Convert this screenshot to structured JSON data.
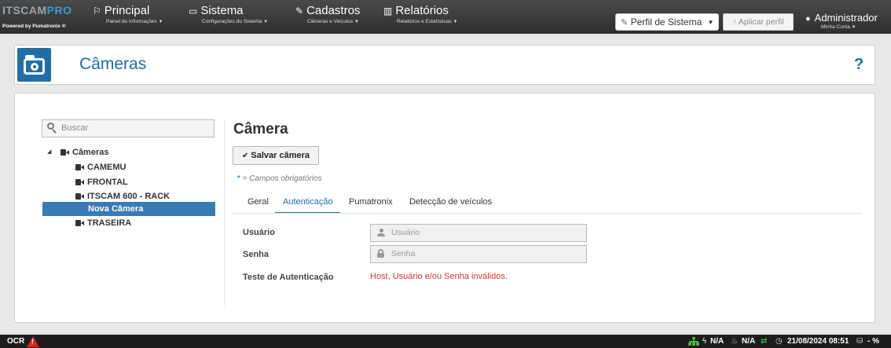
{
  "navbar": {
    "brand_name": "ITSCAMPRO",
    "brand_sub": "Powered by Pumatronix ®",
    "items": [
      {
        "icon": "flag-icon",
        "glyph": "⚐",
        "title": "Principal",
        "subtitle": "Painel de Informações"
      },
      {
        "icon": "monitor-icon",
        "glyph": "▭",
        "title": "Sistema",
        "subtitle": "Configurações do Sistema"
      },
      {
        "icon": "edit-icon",
        "glyph": "✎",
        "title": "Cadastros",
        "subtitle": "Câmeras e Veículos"
      },
      {
        "icon": "bar-chart-icon",
        "glyph": "▥",
        "title": "Relatórios",
        "subtitle": "Relatórios e Estatísticas"
      }
    ],
    "profile_select_value": "Perfil de Sistema",
    "apply_profile_label": "Aplicar perfil",
    "user_name": "Administrador",
    "user_sub": "Minha Conta"
  },
  "page": {
    "title": "Câmeras",
    "help": "?"
  },
  "sidebar": {
    "search_placeholder": "Buscar",
    "tree": {
      "root": "Câmeras",
      "children": [
        "CAMEMU",
        "FRONTAL",
        "ITSCAM 600 - RACK",
        "Nova Câmera",
        "TRASEIRA"
      ],
      "selected": "Nova Câmera"
    }
  },
  "form": {
    "title": "Câmera",
    "save_label": "Salvar câmera",
    "required_marker": "*",
    "required_note": "= Campos obrigatórios",
    "tabs": [
      "Geral",
      "Autenticação",
      "Pumatronix",
      "Detecção de veículos"
    ],
    "active_tab": "Autenticação",
    "fields": {
      "user_label": "Usuário",
      "user_placeholder": "Usuário",
      "password_label": "Senha",
      "password_placeholder": "Senha",
      "auth_test_label": "Teste de Autenticação",
      "auth_test_result": "Host, Usuário e/ou Senha inválidos."
    }
  },
  "statusbar": {
    "ocr_label": "OCR",
    "power_value": "N/A",
    "temp_value": "N/A",
    "datetime": "21/08/2024 08:51",
    "storage_value": "- %"
  },
  "colors": {
    "accent": "#1f6fa6",
    "error": "#d9352c",
    "selected_row": "#3a7ab4",
    "status_ok": "#3fb43a"
  }
}
